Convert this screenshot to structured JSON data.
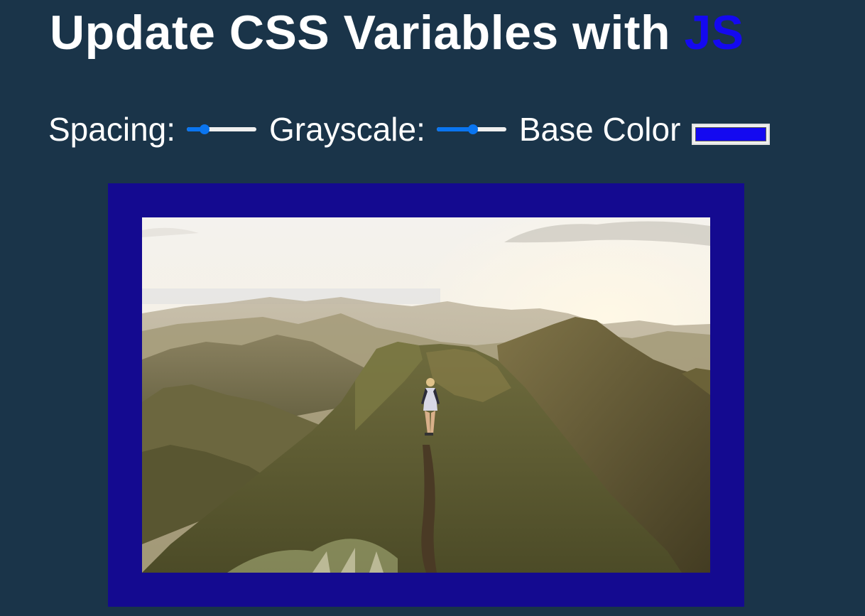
{
  "title": {
    "prefix": "Update CSS Variables with ",
    "highlight": "JS"
  },
  "controls": {
    "spacing": {
      "label": "Spacing:",
      "value_fraction": 0.25
    },
    "grayscale": {
      "label": "Grayscale:",
      "value_fraction": 0.52
    },
    "base_color": {
      "label": "Base Color",
      "value": "#1409f0"
    }
  },
  "colors": {
    "background": "#1a3449",
    "frame": "#140a90",
    "highlight": "#1409f0",
    "slider_accent": "#0a75f0"
  },
  "image": {
    "subject": "hiker-on-mountain-ridge"
  }
}
